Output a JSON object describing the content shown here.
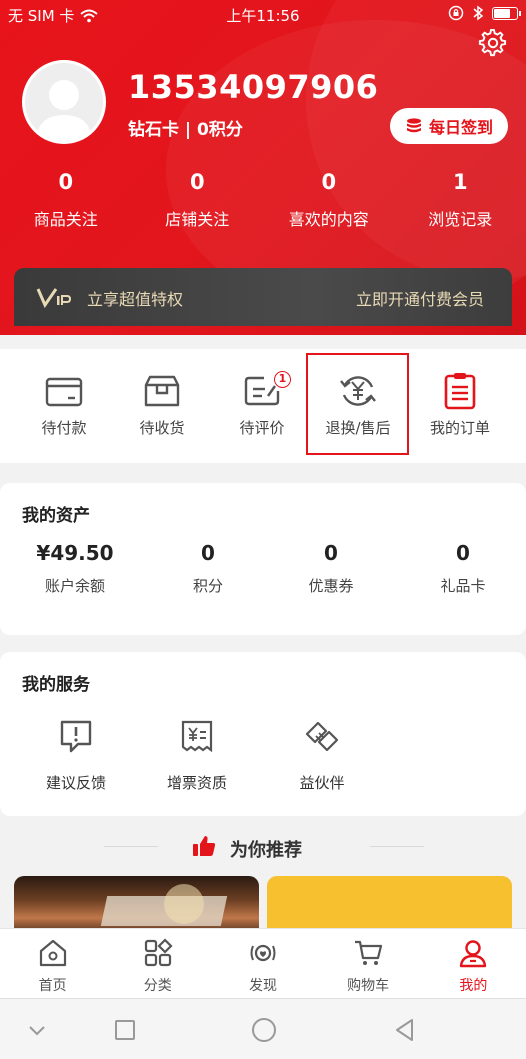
{
  "status_bar": {
    "carrier": "无 SIM 卡",
    "time": "上午11:56",
    "battery_level": 0.75
  },
  "profile": {
    "phone": "13534097906",
    "level": "钻石卡 | 0积分",
    "checkin_label": "每日签到"
  },
  "stats": [
    {
      "value": "0",
      "label": "商品关注"
    },
    {
      "value": "0",
      "label": "店铺关注"
    },
    {
      "value": "0",
      "label": "喜欢的内容"
    },
    {
      "value": "1",
      "label": "浏览记录"
    }
  ],
  "vip": {
    "tagline": "立享超值特权",
    "cta": "立即开通付费会员"
  },
  "orders": [
    {
      "label": "待付款"
    },
    {
      "label": "待收货"
    },
    {
      "label": "待评价",
      "badge": "1"
    },
    {
      "label": "退换/售后"
    },
    {
      "label": "我的订单"
    }
  ],
  "assets": {
    "title": "我的资产",
    "items": [
      {
        "value": "¥49.50",
        "label": "账户余额"
      },
      {
        "value": "0",
        "label": "积分"
      },
      {
        "value": "0",
        "label": "优惠券"
      },
      {
        "value": "0",
        "label": "礼品卡"
      }
    ]
  },
  "services": {
    "title": "我的服务",
    "items": [
      {
        "label": "建议反馈"
      },
      {
        "label": "增票资质"
      },
      {
        "label": "益伙伴"
      }
    ]
  },
  "recommend": {
    "title": "为你推荐"
  },
  "tabs": [
    {
      "label": "首页"
    },
    {
      "label": "分类"
    },
    {
      "label": "发现"
    },
    {
      "label": "购物车"
    },
    {
      "label": "我的",
      "active": true
    }
  ],
  "colors": {
    "brand_red": "#e4141b",
    "vip_gold": "#e8d9b5",
    "vip_dark": "#3d3d3d"
  }
}
